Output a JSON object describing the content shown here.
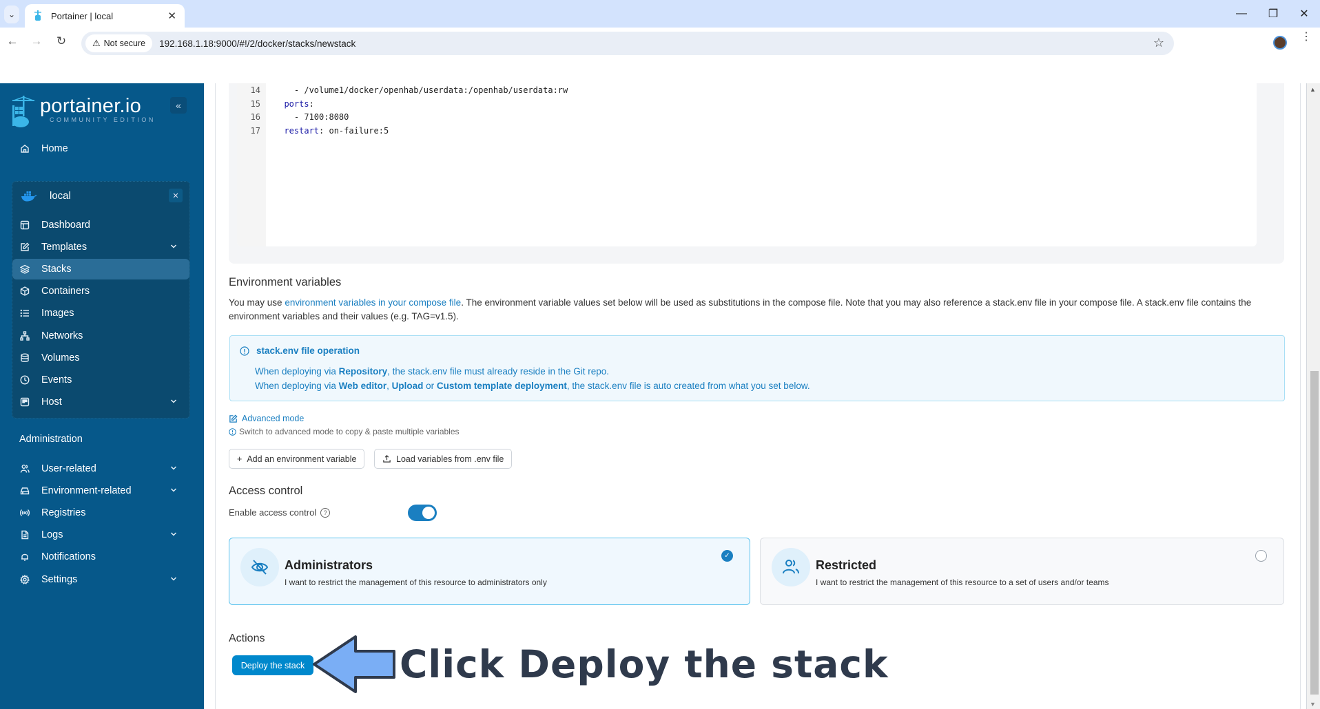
{
  "browser": {
    "tab_title": "Portainer | local",
    "security_label": "Not secure",
    "url": "192.168.1.18:9000/#!/2/docker/stacks/newstack"
  },
  "sidebar": {
    "brand": "portainer.io",
    "edition": "COMMUNITY EDITION",
    "home": "Home",
    "environment": {
      "name": "local",
      "items": [
        {
          "label": "Dashboard",
          "icon": "dashboard-icon",
          "expandable": false
        },
        {
          "label": "Templates",
          "icon": "edit-icon",
          "expandable": true
        },
        {
          "label": "Stacks",
          "icon": "layers-icon",
          "expandable": false,
          "active": true
        },
        {
          "label": "Containers",
          "icon": "box-icon",
          "expandable": false
        },
        {
          "label": "Images",
          "icon": "list-icon",
          "expandable": false
        },
        {
          "label": "Networks",
          "icon": "network-icon",
          "expandable": false
        },
        {
          "label": "Volumes",
          "icon": "database-icon",
          "expandable": false
        },
        {
          "label": "Events",
          "icon": "clock-icon",
          "expandable": false
        },
        {
          "label": "Host",
          "icon": "host-icon",
          "expandable": true
        }
      ]
    },
    "admin_heading": "Administration",
    "admin_items": [
      {
        "label": "User-related",
        "icon": "users-icon",
        "expandable": true
      },
      {
        "label": "Environment-related",
        "icon": "hard-drive-icon",
        "expandable": true
      },
      {
        "label": "Registries",
        "icon": "radio-icon",
        "expandable": false
      },
      {
        "label": "Logs",
        "icon": "file-text-icon",
        "expandable": true
      },
      {
        "label": "Notifications",
        "icon": "bell-icon",
        "expandable": false
      },
      {
        "label": "Settings",
        "icon": "gear-icon",
        "expandable": true
      }
    ]
  },
  "editor": {
    "lines": [
      {
        "n": "14",
        "text": "    - /volume1/docker/openhab/userdata:/openhab/userdata:rw"
      },
      {
        "n": "15",
        "key": "  ports",
        "rest": ":"
      },
      {
        "n": "16",
        "text": "    - 7100:8080"
      },
      {
        "n": "17",
        "key": "  restart",
        "rest": ": on-failure:5"
      }
    ]
  },
  "env_vars": {
    "title": "Environment variables",
    "intro_prefix": "You may use ",
    "intro_link": "environment variables in your compose file",
    "intro_suffix": ". The environment variable values set below will be used as substitutions in the compose file. Note that you may also reference a stack.env file in your compose file. A stack.env file contains the environment variables and their values (e.g. TAG=v1.5).",
    "info": {
      "title": "stack.env file operation",
      "line1_a": "When deploying via ",
      "line1_b": "Repository",
      "line1_c": ", the stack.env file must already reside in the Git repo.",
      "line2_a": "When deploying via ",
      "line2_b": "Web editor",
      "line2_c": ", ",
      "line2_d": "Upload",
      "line2_e": " or ",
      "line2_f": "Custom template deployment",
      "line2_g": ", the stack.env file is auto created from what you set below."
    },
    "advanced_mode": "Advanced mode",
    "advanced_hint": "Switch to advanced mode to copy & paste multiple variables",
    "add_button": "Add an environment variable",
    "load_button": "Load variables from .env file"
  },
  "access_control": {
    "title": "Access control",
    "enable_label": "Enable access control",
    "enabled": true,
    "options": [
      {
        "title": "Administrators",
        "desc": "I want to restrict the management of this resource to administrators only",
        "selected": true
      },
      {
        "title": "Restricted",
        "desc": "I want to restrict the management of this resource to a set of users and/or teams",
        "selected": false
      }
    ]
  },
  "actions": {
    "title": "Actions",
    "deploy_button": "Deploy the stack"
  },
  "annotation": {
    "text": "Click Deploy the stack"
  },
  "colors": {
    "sidebar_bg": "#06588a",
    "accent": "#0088cc",
    "link": "#1a7fc1"
  }
}
